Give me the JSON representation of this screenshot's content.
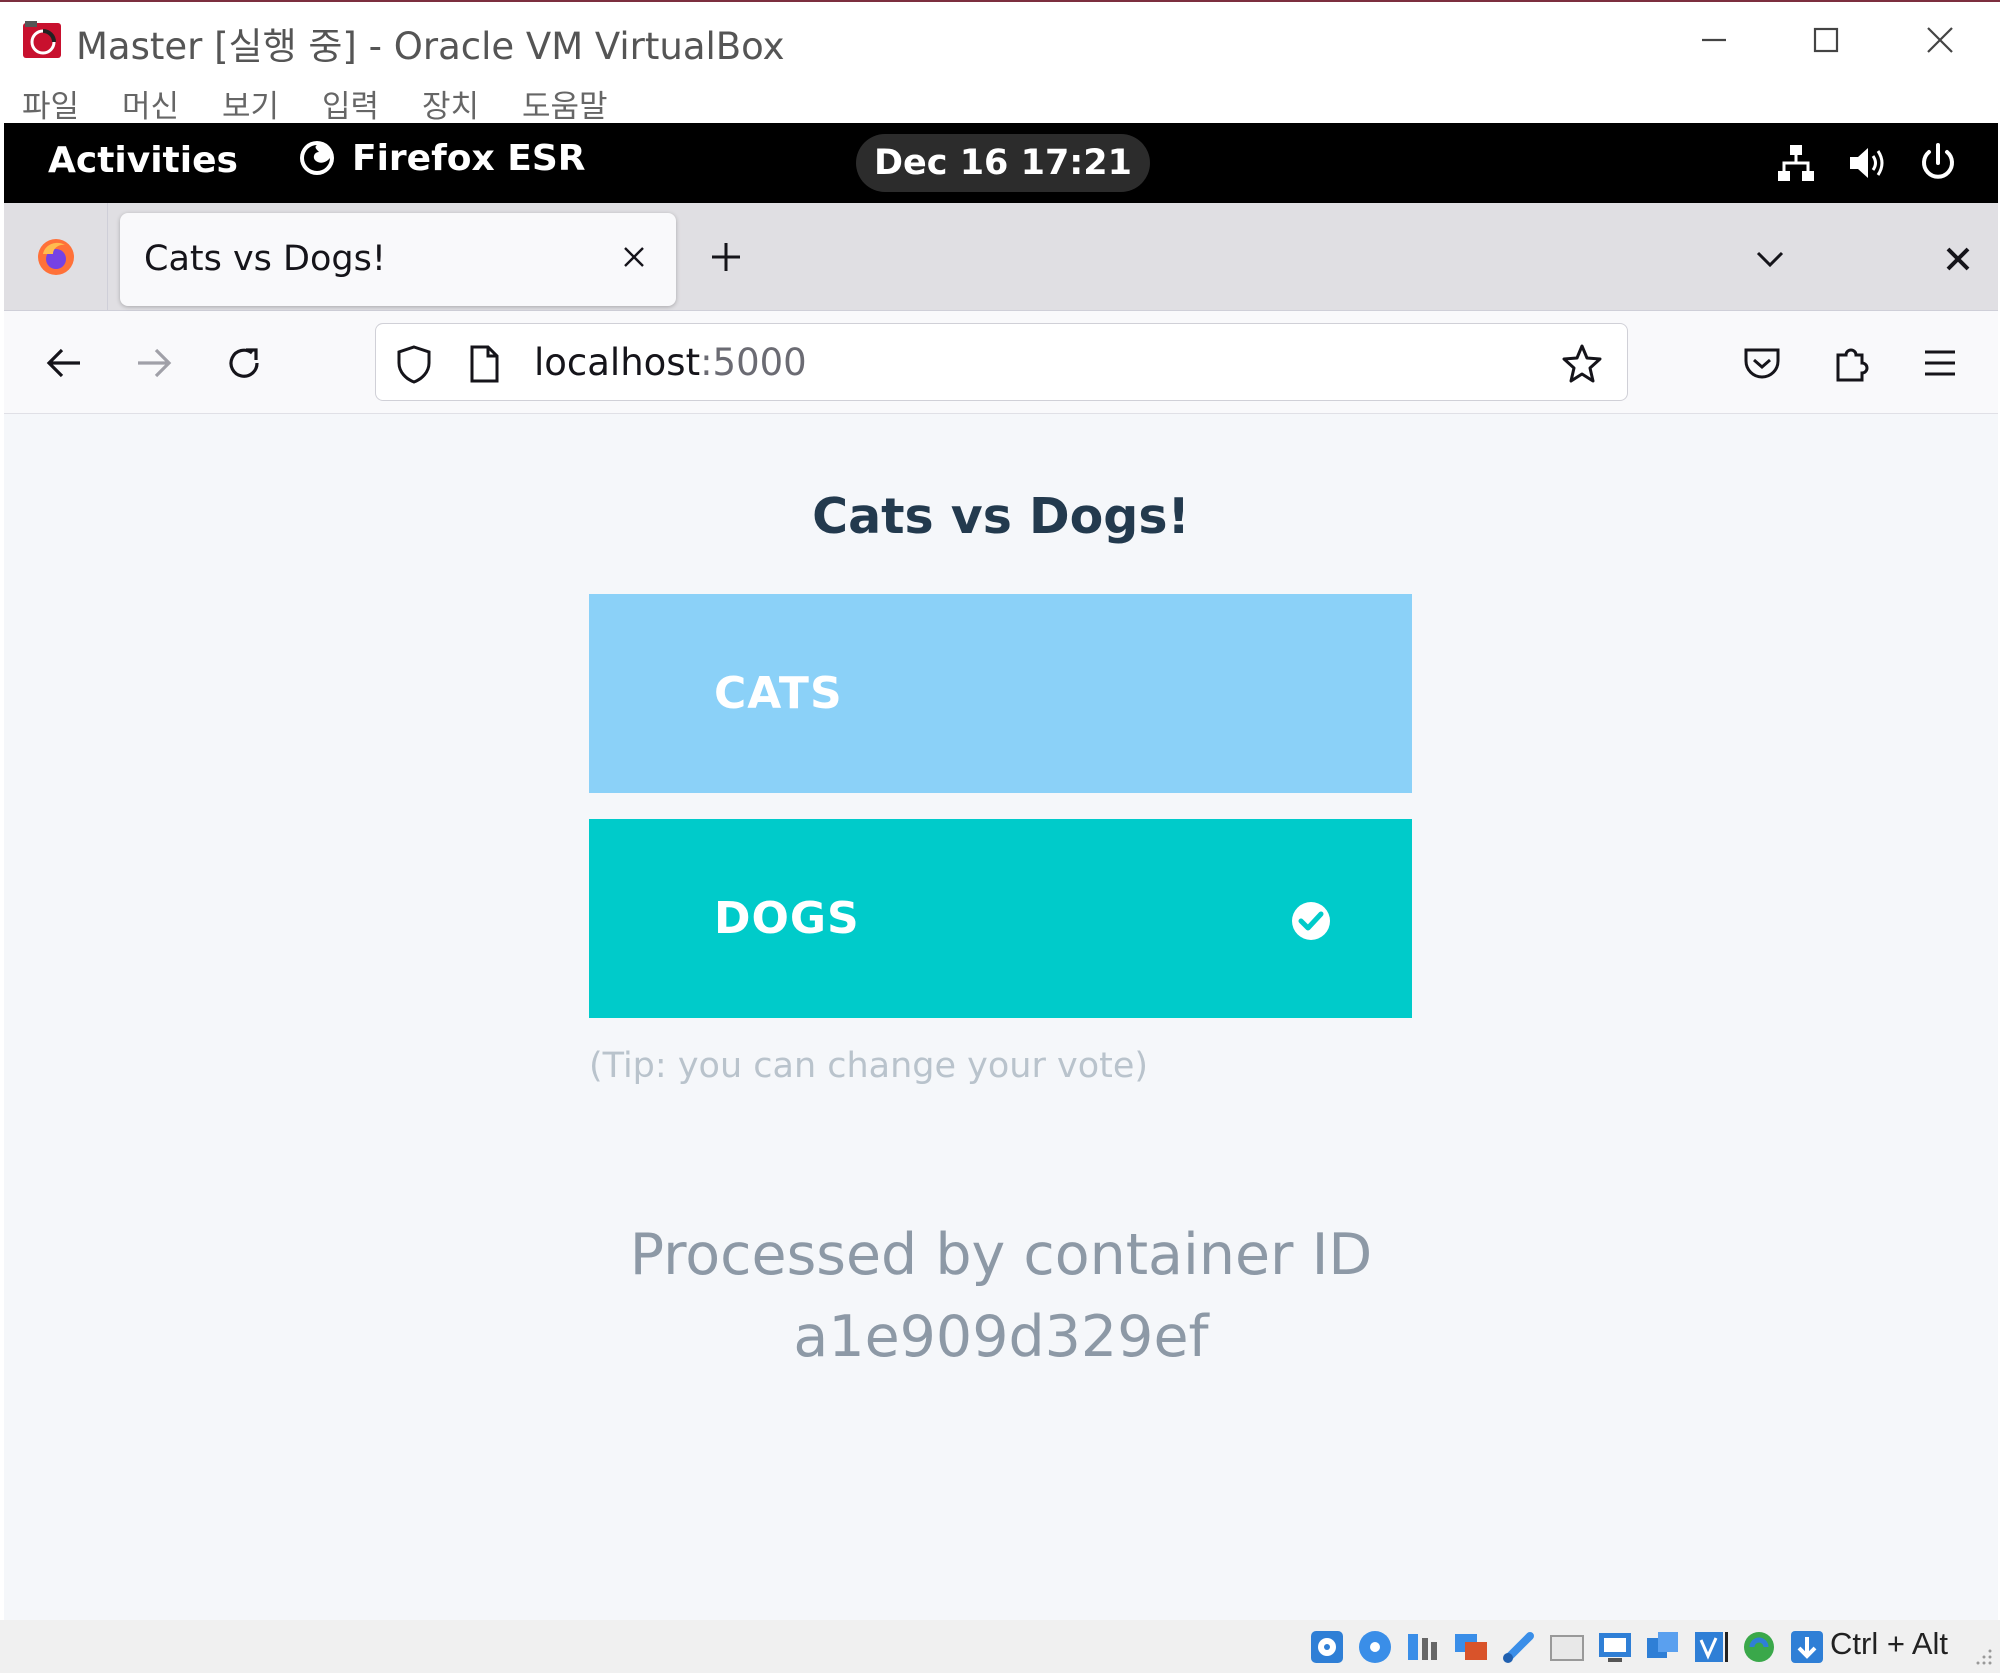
{
  "vbox_window": {
    "title": "Master [실행 중] - Oracle VM VirtualBox",
    "menu": [
      "파일",
      "머신",
      "보기",
      "입력",
      "장치",
      "도움말"
    ],
    "host_key": "Ctrl + Alt"
  },
  "gnome": {
    "activities": "Activities",
    "app_name": "Firefox ESR",
    "clock": "Dec 16  17:21"
  },
  "browser": {
    "tab_title": "Cats vs Dogs!",
    "url_host": "localhost",
    "url_port": ":5000"
  },
  "page": {
    "title": "Cats vs Dogs!",
    "option_a": "CATS",
    "option_b": "DOGS",
    "selected": "DOGS",
    "tip": "(Tip: you can change your vote)",
    "processed_line1": "Processed by container ID",
    "processed_line2": "a1e909d329ef"
  },
  "colors": {
    "cats_button": "#8bd1f8",
    "dogs_button": "#00cbca",
    "title_text": "#233a4e",
    "page_bg": "#f5f7fa"
  },
  "icons": {
    "status_bar": [
      "hard-disk-icon",
      "optical-drive-icon",
      "audio-icon",
      "network-icon",
      "usb-icon",
      "shared-folders-icon",
      "display-icon",
      "recording-icon",
      "vm-icon",
      "cpu-icon",
      "mouse-integration-icon",
      "keyboard-capture-icon"
    ]
  }
}
